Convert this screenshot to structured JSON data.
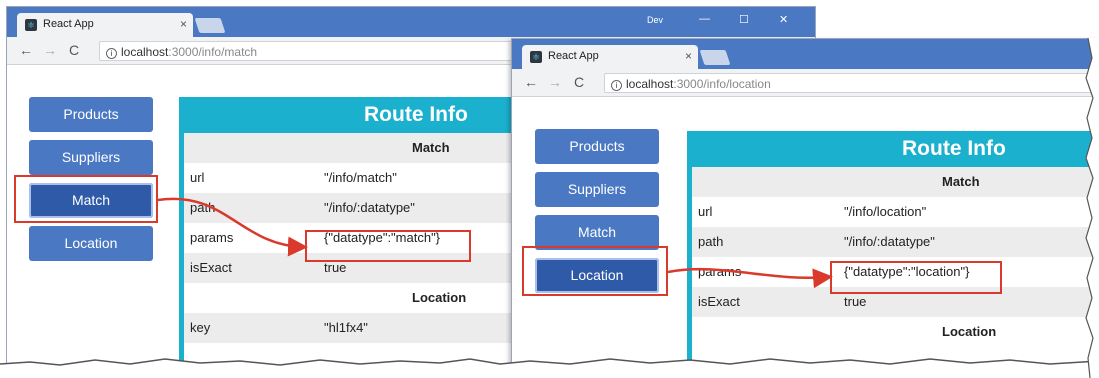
{
  "window1": {
    "profile": "Dev",
    "tab_title": "React App",
    "url_host": "localhost",
    "url_rest": ":3000/info/match",
    "buttons": [
      "Products",
      "Suppliers",
      "Match",
      "Location"
    ],
    "active_button": "Match",
    "panel_title": "Route Info",
    "match_heading": "Match",
    "rows": [
      {
        "key": "url",
        "value": "\"/info/match\""
      },
      {
        "key": "path",
        "value": "\"/info/:datatype\""
      },
      {
        "key": "params",
        "value": "{\"datatype\":\"match\"}"
      },
      {
        "key": "isExact",
        "value": "true"
      }
    ],
    "location_heading": "Location",
    "location_rows": [
      {
        "key": "key",
        "value": "\"hl1fx4\""
      }
    ]
  },
  "window2": {
    "tab_title": "React App",
    "url_host": "localhost",
    "url_rest": ":3000/info/location",
    "buttons": [
      "Products",
      "Suppliers",
      "Match",
      "Location"
    ],
    "active_button": "Location",
    "panel_title": "Route Info",
    "match_heading": "Match",
    "rows": [
      {
        "key": "url",
        "value": "\"/info/location\""
      },
      {
        "key": "path",
        "value": "\"/info/:datatype\""
      },
      {
        "key": "params",
        "value": "{\"datatype\":\"location\"}"
      },
      {
        "key": "isExact",
        "value": "true"
      }
    ],
    "location_heading": "Location"
  },
  "icons": {
    "tab_close": "close-icon",
    "new_tab": "new-tab-icon",
    "back": "back-arrow-icon",
    "forward": "forward-arrow-icon",
    "reload": "reload-icon",
    "site_info": "info-icon",
    "minimize": "minimize-icon",
    "maximize": "maximize-icon",
    "window_close": "window-close-icon"
  },
  "colors": {
    "titlebar": "#4a78c2",
    "button": "#4a78c2",
    "button_active": "#2f5aa8",
    "panel_header": "#1bb0ce",
    "highlight": "#d93a2b"
  }
}
